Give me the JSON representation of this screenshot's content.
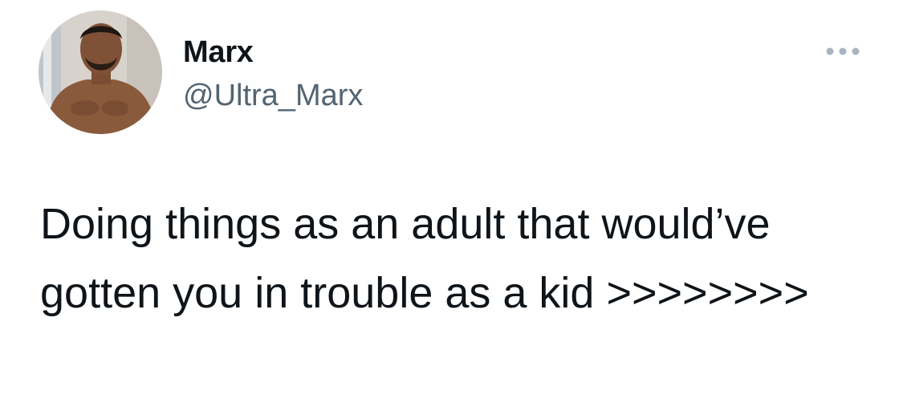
{
  "tweet": {
    "author": {
      "display_name": "Marx",
      "handle": "@Ultra_Marx",
      "avatar_icon": "profile-photo"
    },
    "more_icon": "more-horizontal-icon",
    "text": "Doing things as an adult that would’ve gotten you in trouble as a kid >>>>>>>>"
  },
  "colors": {
    "text_primary": "#0f1419",
    "text_secondary": "#536471",
    "more_dots": "#a8b4bf",
    "background": "#ffffff"
  }
}
